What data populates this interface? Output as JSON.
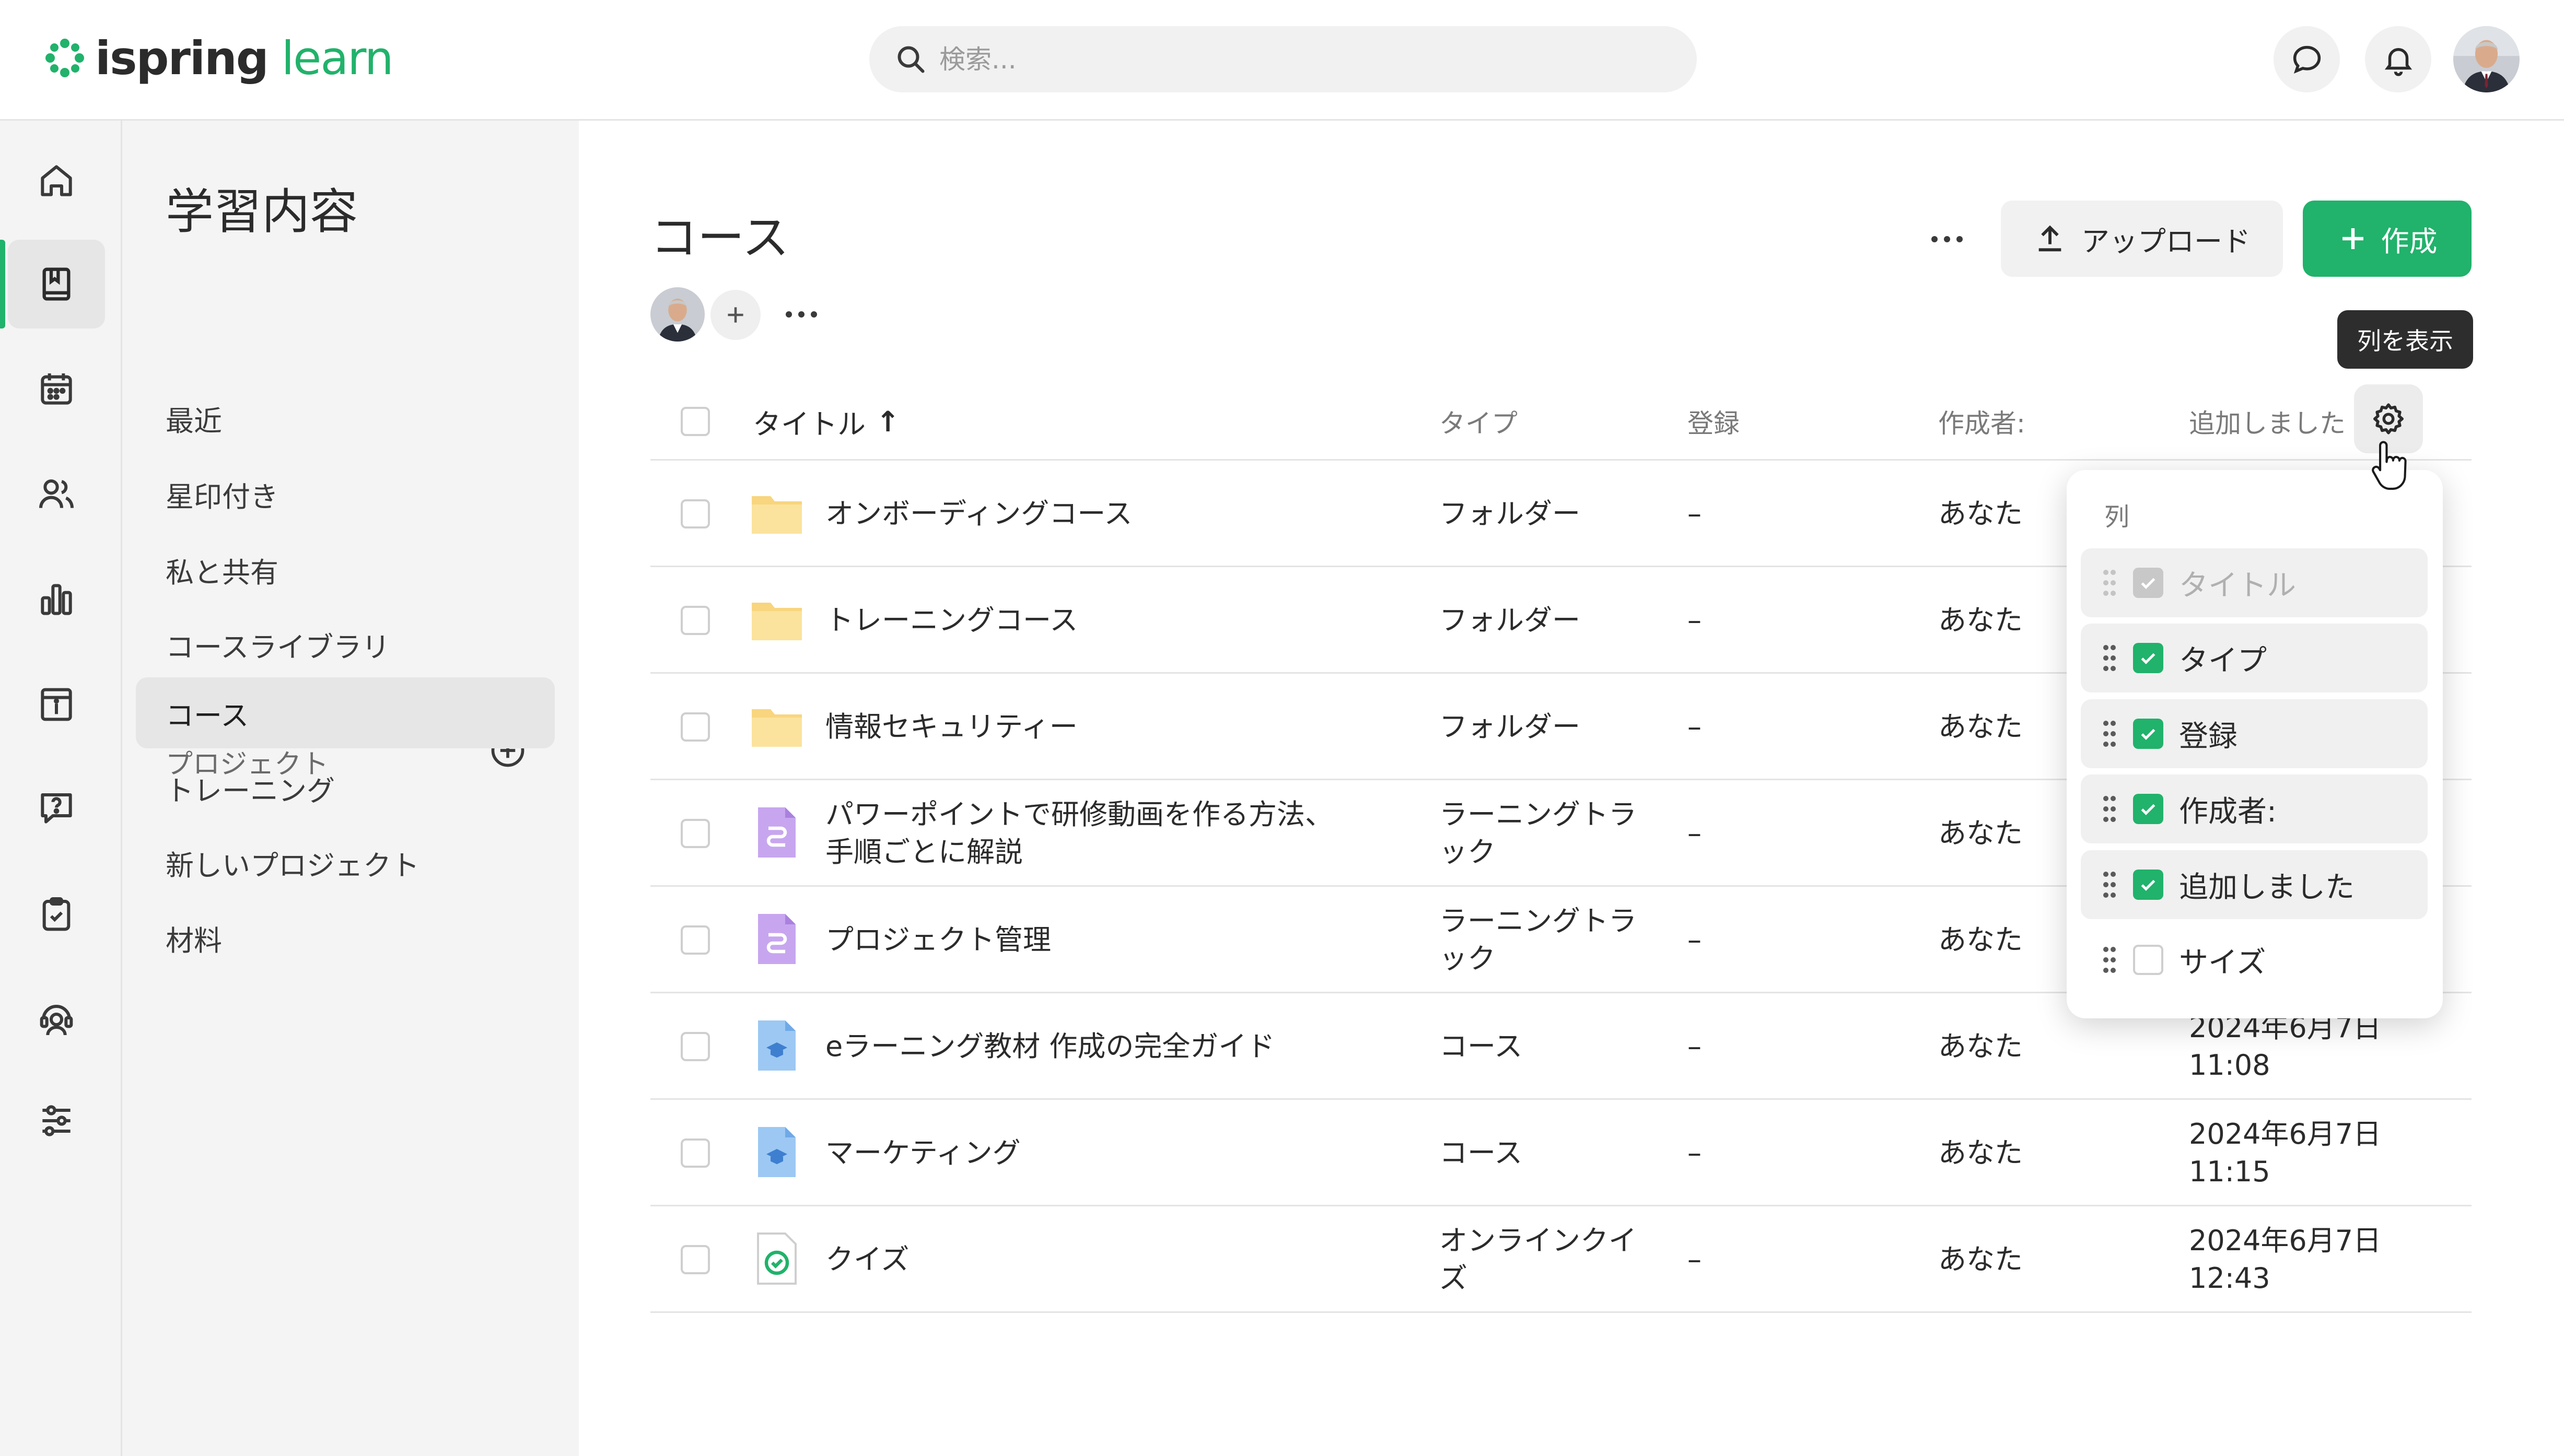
{
  "brand": {
    "name_part1": "ispring",
    "name_part2": " learn",
    "accent": "#21b26b"
  },
  "search": {
    "placeholder": "検索..."
  },
  "section_nav": {
    "title": "学習内容",
    "items": [
      "最近",
      "星印付き",
      "私と共有",
      "コースライブラリ"
    ],
    "projects_label": "プロジェクト",
    "projects": [
      "コース",
      "トレーニング",
      "新しいプロジェクト",
      "材料"
    ],
    "active": "コース"
  },
  "main": {
    "title": "コース",
    "upload_label": "アップロード",
    "create_label": "作成",
    "tooltip": "列を表示"
  },
  "table": {
    "columns": [
      "タイトル",
      "タイプ",
      "登録",
      "作成者:",
      "追加しました"
    ],
    "sort_indicator": "↑",
    "rows": [
      {
        "icon": "folder-icon",
        "title": "オンボーディングコース",
        "type": "フォルダー",
        "enroll": "–",
        "author": "あなた",
        "added": ""
      },
      {
        "icon": "folder-icon",
        "title": "トレーニングコース",
        "type": "フォルダー",
        "enroll": "–",
        "author": "あなた",
        "added": ""
      },
      {
        "icon": "folder-icon",
        "title": "情報セキュリティー",
        "type": "フォルダー",
        "enroll": "–",
        "author": "あなた",
        "added": ""
      },
      {
        "icon": "learning-track-icon",
        "title_line1": "パワーポイントで研修動画を作る方法、",
        "title_line2": "手順ごとに解説",
        "type_line1": "ラーニングトラ",
        "type_line2": "ック",
        "enroll": "–",
        "author": "あなた",
        "added": ""
      },
      {
        "icon": "learning-track-icon",
        "title": "プロジェクト管理",
        "type_line1": "ラーニングトラ",
        "type_line2": "ック",
        "enroll": "–",
        "author": "あなた",
        "added": ""
      },
      {
        "icon": "course-icon",
        "title": "eラーニング教材 作成の完全ガイド",
        "type": "コース",
        "enroll": "–",
        "author": "あなた",
        "added_date": "2024年6月7日",
        "added_time": "11:08"
      },
      {
        "icon": "course-icon",
        "title": "マーケティング",
        "type": "コース",
        "enroll": "–",
        "author": "あなた",
        "added_date": "2024年6月7日",
        "added_time": "11:15"
      },
      {
        "icon": "quiz-icon",
        "title": "クイズ",
        "type_line1": "オンラインクイ",
        "type_line2": "ズ",
        "enroll": "–",
        "author": "あなた",
        "added_date": "2024年6月7日",
        "added_time": "12:43"
      }
    ]
  },
  "columns_menu": {
    "header": "列",
    "items": [
      {
        "label": "タイトル",
        "state": "disabled"
      },
      {
        "label": "タイプ",
        "state": "checked"
      },
      {
        "label": "登録",
        "state": "checked"
      },
      {
        "label": "作成者:",
        "state": "checked"
      },
      {
        "label": "追加しました",
        "state": "checked"
      },
      {
        "label": "サイズ",
        "state": "unchecked"
      }
    ]
  }
}
